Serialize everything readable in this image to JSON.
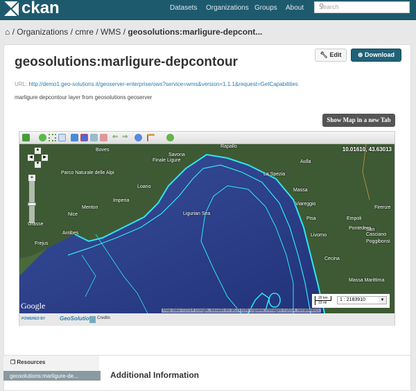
{
  "nav": {
    "logo": "ckan",
    "links": [
      "Datasets",
      "Organizations",
      "Groups",
      "About"
    ],
    "search_placeholder": "Search"
  },
  "breadcrumb": {
    "items": [
      "Organizations",
      "cmre",
      "WMS"
    ],
    "current": "geosolutions:marligure-depcont..."
  },
  "actions": {
    "edit": "Edit",
    "download": "Download"
  },
  "dataset": {
    "title": "geosolutions:marligure-depcontour",
    "url_label": "URL:",
    "url": "http://demo1.geo-solutions.it/geoserver-enterprise/ows?service=wms&version=1.1.1&request=GetCapabilities",
    "description": "marligure depcontour layer from geosolutions geoserver"
  },
  "map": {
    "show_button": "Show Map in a new Tab",
    "coords": "10.01610, 43.63013",
    "google": "Google",
    "attribution": "Map data ©2014 Google, basado en BCN IGN España Immagini ©2014 TerraMetrics",
    "scale_km": "20 km",
    "scale_mi": "10 mi",
    "scale": "1 : 2183910",
    "places": [
      "Boves",
      "Finale Ligure",
      "Savona",
      "Rapallo",
      "Aulla",
      "La Spezia",
      "Massa",
      "Viareggio",
      "Pisa",
      "Livorno",
      "Firenze",
      "Empoli",
      "Cecina",
      "Nice",
      "Menton",
      "Imperia",
      "Loano",
      "Grasse",
      "Antibes",
      "Frejus",
      "Ligurian Sea",
      "Parco Naturale delle Alpi",
      "Pontedera",
      "San Casciano",
      "Poggibonsi",
      "Massa Marittima"
    ],
    "powered_by": "POWERED BY",
    "brand": "GeoSolutions",
    "credits": "Credits",
    "contour_color": "#2de8f0"
  },
  "sidebar": {
    "resources": "Resources",
    "item": "geosolutions:marligure-de..."
  },
  "main": {
    "heading": "Additional Information"
  }
}
